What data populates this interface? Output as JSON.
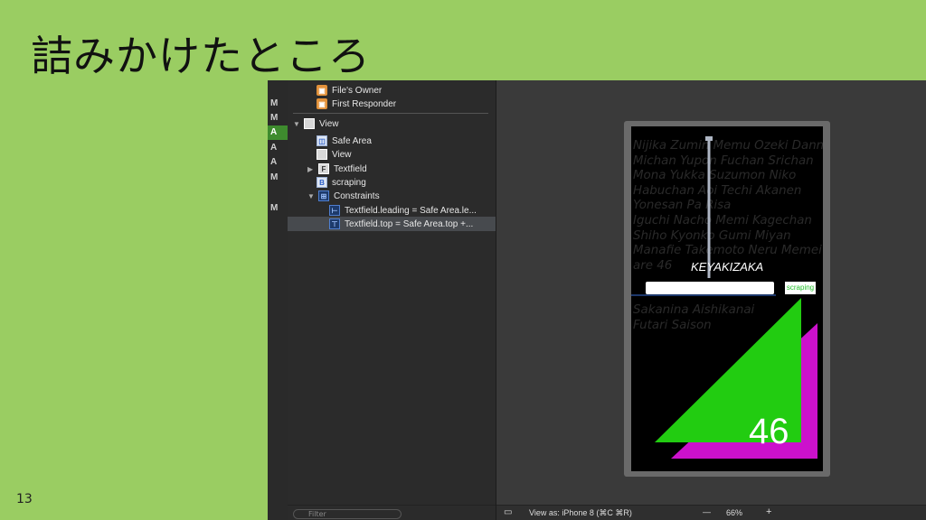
{
  "slide": {
    "title": "詰みかけたところ",
    "page_number": "13"
  },
  "gutter": [
    "M",
    "M",
    "A",
    "A",
    "A",
    "M",
    "",
    "M"
  ],
  "outline": {
    "items": [
      {
        "label": "File's Owner",
        "icon": "cube-icon"
      },
      {
        "label": "First Responder",
        "icon": "cube-icon"
      },
      {
        "label": "View",
        "icon": "view-icon"
      },
      {
        "label": "Safe Area",
        "icon": "safe-area-icon"
      },
      {
        "label": "View",
        "icon": "view-icon"
      },
      {
        "label": "Textfield",
        "icon_text": "F"
      },
      {
        "label": "scraping",
        "icon_text": "B"
      },
      {
        "label": "Constraints",
        "icon": "constraints-icon"
      },
      {
        "label": "Textfield.leading = Safe Area.le...",
        "icon": "constraint-icon"
      },
      {
        "label": "Textfield.top = Safe Area.top +...",
        "icon": "constraint-icon"
      }
    ],
    "filter_placeholder": "Filter"
  },
  "canvas": {
    "names_lines": [
      "Nijika Zumin Memu Ozeki Danni",
      "Michan Yupon Fuchan Srichan",
      "Mona Yukka Suzumon Niko",
      "Habuchan Aoi Techi Akanen",
      "Yonesan Pa Risa",
      "Iguchi Nacho Memi Kagechan",
      "Shiho Kyonko Gumi Miyan",
      "Manafie Takemoto Neru Memei",
      "are                           46"
    ],
    "names_lines_below": [
      "Sakanina Aishikanai",
      "Futari Saison"
    ],
    "banner": "KEYAKIZAKA",
    "button_label": "scraping",
    "big_number": "46"
  },
  "bottombar": {
    "view_as": "View as: iPhone 8 (⌘C ⌘R)",
    "zoom": "66%",
    "minus": "—",
    "plus": "+"
  },
  "colors": {
    "slide_bg": "#9acd62",
    "green": "#22cc11",
    "magenta": "#cc11cc"
  }
}
